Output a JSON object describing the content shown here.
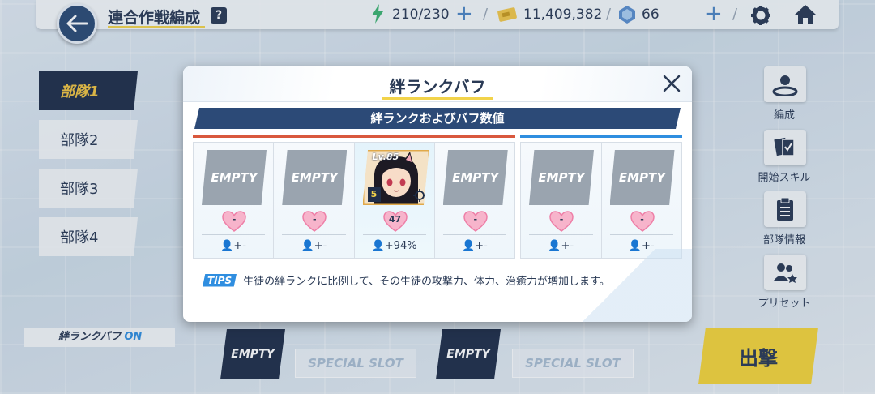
{
  "header": {
    "title": "連合作戦編成",
    "help_label": "?",
    "ap": "210/230",
    "credits": "11,409,382",
    "pyroxene": "66"
  },
  "squads": [
    {
      "label": "部隊1",
      "active": true
    },
    {
      "label": "部隊2",
      "active": false
    },
    {
      "label": "部隊3",
      "active": false
    },
    {
      "label": "部隊4",
      "active": false
    }
  ],
  "side_menu": [
    {
      "label": "編成",
      "icon": "formation-icon"
    },
    {
      "label": "開始スキル",
      "icon": "start-skill-icon"
    },
    {
      "label": "部隊情報",
      "icon": "squad-info-icon"
    },
    {
      "label": "プリセット",
      "icon": "preset-icon"
    }
  ],
  "bottom": {
    "bond_toggle_label": "絆ランクバフ",
    "bond_toggle_state": "ON",
    "slot1": "EMPTY",
    "special1": "SPECIAL SLOT",
    "slot2": "EMPTY",
    "special2": "SPECIAL SLOT",
    "sortie_label": "出撃"
  },
  "modal": {
    "title": "絆ランクバフ",
    "section_title": "絆ランクおよびバフ数値",
    "striker_slots": [
      {
        "type": "empty",
        "card_label": "EMPTY",
        "bond_rank": "-",
        "buff": "-"
      },
      {
        "type": "empty",
        "card_label": "EMPTY",
        "bond_rank": "-",
        "buff": "-"
      },
      {
        "type": "filled",
        "level": "Lv.85",
        "stars": "5",
        "bond_rank": "47",
        "buff": "94%"
      },
      {
        "type": "empty",
        "card_label": "EMPTY",
        "bond_rank": "-",
        "buff": "-"
      }
    ],
    "special_slots": [
      {
        "type": "empty",
        "card_label": "EMPTY",
        "bond_rank": "-",
        "buff": "-"
      },
      {
        "type": "empty",
        "card_label": "EMPTY",
        "bond_rank": "-",
        "buff": "-"
      }
    ],
    "tips_badge": "TIPS",
    "tips_text": "生徒の絆ランクに比例して、その生徒の攻撃力、体力、治癒力が増加します。"
  },
  "colors": {
    "navy": "#1f2e49",
    "accent_yellow": "#f2d34a",
    "striker_red": "#d9583d",
    "special_blue": "#2f8ee0",
    "heart_pink": "#f48fb1"
  }
}
